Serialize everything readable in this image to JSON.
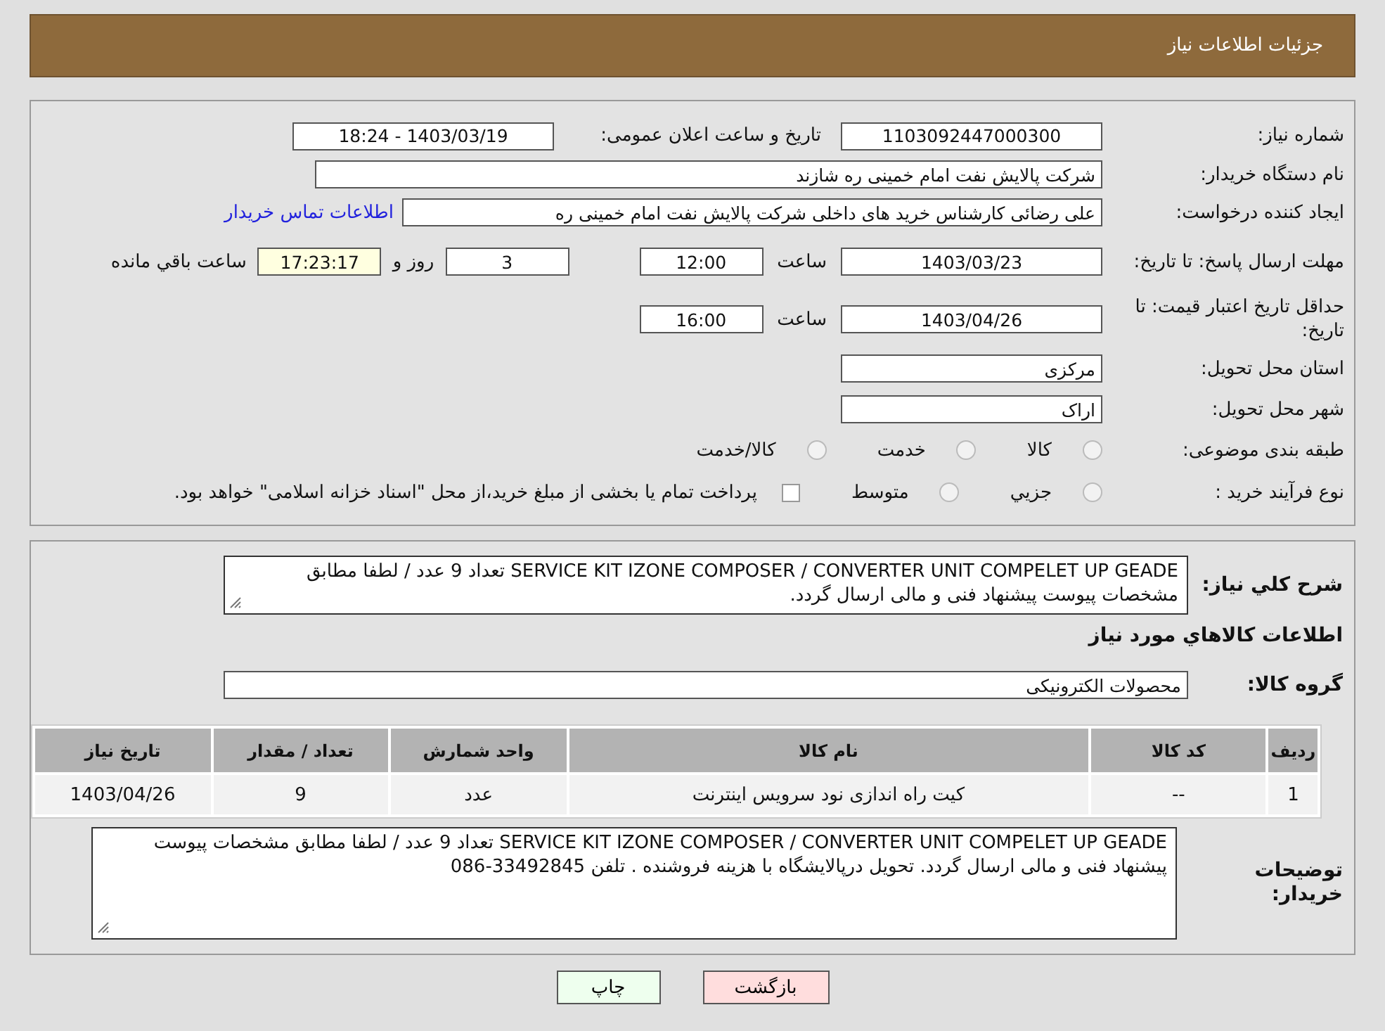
{
  "header": {
    "title": "جزئیات اطلاعات نیاز"
  },
  "need_number": {
    "label": "شماره نیاز:",
    "value": "1103092447000300"
  },
  "announce_date": {
    "label": "تاریخ و ساعت اعلان عمومی:",
    "value": "1403/03/19 - 18:24"
  },
  "buyer_org": {
    "label": "نام دستگاه خریدار:",
    "value": "شرکت پالایش نفت امام خمینی  ره  شازند"
  },
  "requester": {
    "label": "ایجاد کننده درخواست:",
    "value": "علی  رضائی کارشناس خرید های داخلی  شرکت پالایش نفت امام خمینی  ره",
    "link": "اطلاعات تماس خریدار"
  },
  "reply_deadline": {
    "label": "مهلت ارسال پاسخ: تا تاریخ:",
    "date": "1403/03/23",
    "time_label": "ساعت",
    "time": "12:00",
    "days": "3",
    "days_label": "روز و",
    "remaining": "17:23:17",
    "remaining_label": "ساعت باقي مانده"
  },
  "price_validity": {
    "label": "حداقل تاریخ اعتبار قیمت: تا تاریخ:",
    "date": "1403/04/26",
    "time_label": "ساعت",
    "time": "16:00"
  },
  "province": {
    "label": "استان محل تحویل:",
    "value": "مرکزی"
  },
  "city": {
    "label": "شهر محل تحویل:",
    "value": "اراک"
  },
  "category": {
    "label": "طبقه بندی موضوعی:",
    "options": [
      {
        "label": "کالا",
        "selected": false
      },
      {
        "label": "خدمت",
        "selected": false
      },
      {
        "label": "کالا/خدمت",
        "selected": false
      }
    ]
  },
  "process": {
    "label": "نوع فرآیند خرید :",
    "options": [
      {
        "label": "جزيي",
        "selected": false
      },
      {
        "label": "متوسط",
        "selected": false
      }
    ],
    "treasury": {
      "checked": false,
      "label": "پرداخت تمام یا بخشی از مبلغ خرید،از محل \"اسناد خزانه اسلامی\" خواهد بود."
    }
  },
  "summary": {
    "label": "شرح کلي نیاز:",
    "value": "SERVICE KIT IZONE COMPOSER / CONVERTER UNIT COMPELET  UP GEADE  تعداد 9  عدد / لطفا مطابق مشخصات پیوست پیشنهاد فنی و مالی ارسال گردد."
  },
  "goods_heading": "اطلاعات کالاهاي مورد نیاز",
  "goods_group": {
    "label": "گروه کالا:",
    "value": "محصولات الکترونیکی"
  },
  "table": {
    "columns": [
      "ردیف",
      "کد کالا",
      "نام کالا",
      "واحد شمارش",
      "تعداد / مقدار",
      "تاریخ نیاز"
    ],
    "rows": [
      [
        "1",
        "--",
        "کیت راه اندازی نود سرویس اینترنت",
        "عدد",
        "9",
        "1403/04/26"
      ]
    ]
  },
  "buyer_notes": {
    "label": "توضیحات خریدار:",
    "value": "SERVICE KIT IZONE COMPOSER / CONVERTER UNIT COMPELET  UP GEADE  تعداد 9  عدد / لطفا مطابق مشخصات پیوست پیشنهاد فنی و مالی ارسال گردد.   تحویل درپالایشگاه با هزینه فروشنده . تلفن 33492845-086"
  },
  "buttons": [
    {
      "kind": "back",
      "label": "بازگشت"
    },
    {
      "kind": "print",
      "label": "چاپ"
    }
  ]
}
